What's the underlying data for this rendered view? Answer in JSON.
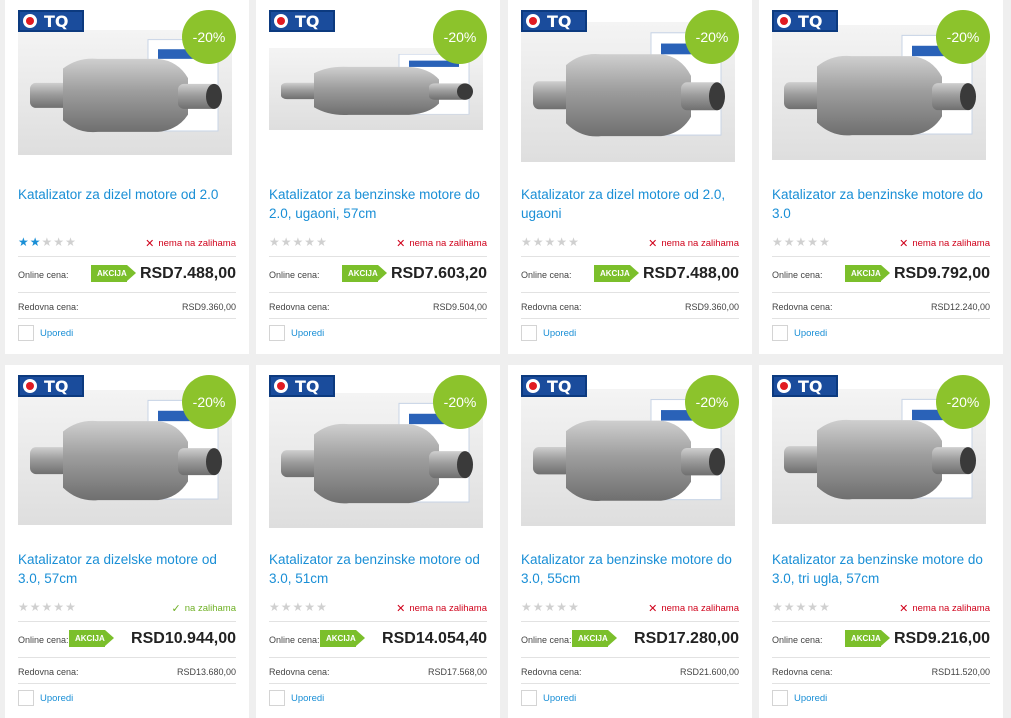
{
  "products": [
    {
      "brand": "TQ",
      "discount": "-20%",
      "title": "Katalizator za dizel motore od 2.0",
      "rating": 2,
      "stock": "nema na zalihama",
      "in_stock": false,
      "online_label": "Online cena:",
      "promo": "AKCIJA",
      "price": "RSD7.488,00",
      "regular_label": "Redovna cena:",
      "regular_price": "RSD9.360,00",
      "compare": "Uporedi"
    },
    {
      "brand": "TQ",
      "discount": "-20%",
      "title": "Katalizator za benzinske motore do 2.0, ugaoni, 57cm",
      "rating": 0,
      "stock": "nema na zalihama",
      "in_stock": false,
      "online_label": "Online cena:",
      "promo": "AKCIJA",
      "price": "RSD7.603,20",
      "regular_label": "Redovna cena:",
      "regular_price": "RSD9.504,00",
      "compare": "Uporedi"
    },
    {
      "brand": "TQ",
      "discount": "-20%",
      "title": "Katalizator za dizel motore od 2.0, ugaoni",
      "rating": 0,
      "stock": "nema na zalihama",
      "in_stock": false,
      "online_label": "Online cena:",
      "promo": "AKCIJA",
      "price": "RSD7.488,00",
      "regular_label": "Redovna cena:",
      "regular_price": "RSD9.360,00",
      "compare": "Uporedi"
    },
    {
      "brand": "TQ",
      "discount": "-20%",
      "title": "Katalizator za benzinske motore do 3.0",
      "rating": 0,
      "stock": "nema na zalihama",
      "in_stock": false,
      "online_label": "Online cena:",
      "promo": "AKCIJA",
      "price": "RSD9.792,00",
      "regular_label": "Redovna cena:",
      "regular_price": "RSD12.240,00",
      "compare": "Uporedi"
    },
    {
      "brand": "TQ",
      "discount": "-20%",
      "title": "Katalizator za dizelske motore od 3.0, 57cm",
      "rating": 0,
      "stock": "na zalihama",
      "in_stock": true,
      "online_label": "Online cena:",
      "promo": "AKCIJA",
      "price": "RSD10.944,00",
      "regular_label": "Redovna cena:",
      "regular_price": "RSD13.680,00",
      "compare": "Uporedi"
    },
    {
      "brand": "TQ",
      "discount": "-20%",
      "title": "Katalizator za benzinske motore od 3.0, 51cm",
      "rating": 0,
      "stock": "nema na zalihama",
      "in_stock": false,
      "online_label": "Online cena:",
      "promo": "AKCIJA",
      "price": "RSD14.054,40",
      "regular_label": "Redovna cena:",
      "regular_price": "RSD17.568,00",
      "compare": "Uporedi"
    },
    {
      "brand": "TQ",
      "discount": "-20%",
      "title": "Katalizator za benzinske motore do 3.0, 55cm",
      "rating": 0,
      "stock": "nema na zalihama",
      "in_stock": false,
      "online_label": "Online cena:",
      "promo": "AKCIJA",
      "price": "RSD17.280,00",
      "regular_label": "Redovna cena:",
      "regular_price": "RSD21.600,00",
      "compare": "Uporedi"
    },
    {
      "brand": "TQ",
      "discount": "-20%",
      "title": "Katalizator za benzinske motore do 3.0, tri ugla, 57cm",
      "rating": 0,
      "stock": "nema na zalihama",
      "in_stock": false,
      "online_label": "Online cena:",
      "promo": "AKCIJA",
      "price": "RSD9.216,00",
      "regular_label": "Redovna cena:",
      "regular_price": "RSD11.520,00",
      "compare": "Uporedi"
    }
  ],
  "colors": {
    "accent": "#1a8fd6",
    "badge": "#8cc32c",
    "promo": "#7bbf2b",
    "out_of_stock": "#d0021b",
    "in_stock": "#6fb025",
    "brand_logo": "#1a4c9c"
  },
  "icons": {
    "in_stock": "check-icon",
    "out_of_stock": "cross-icon",
    "rating": "star-icon"
  }
}
